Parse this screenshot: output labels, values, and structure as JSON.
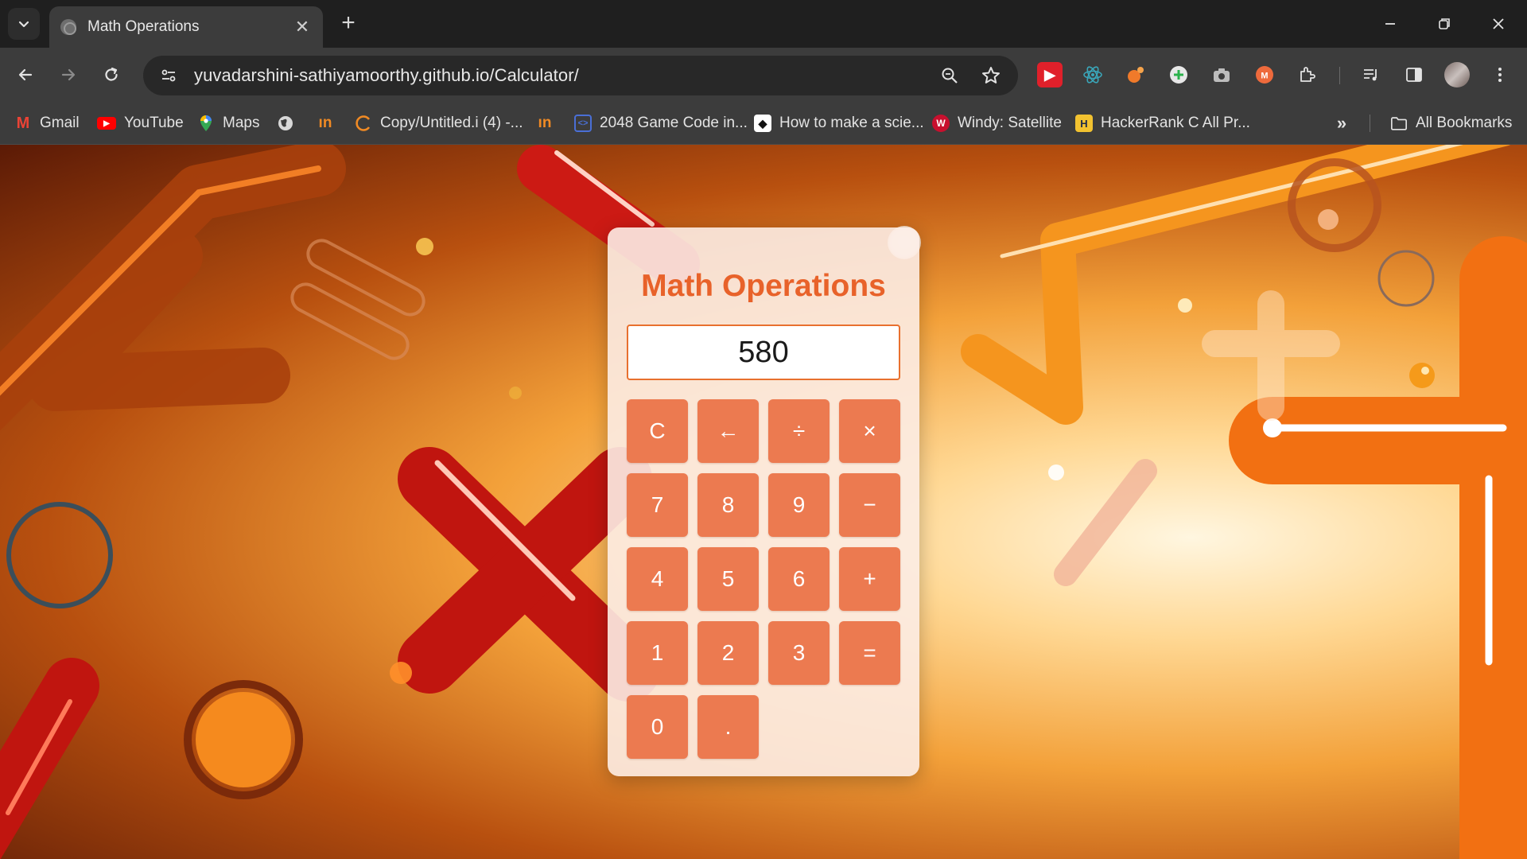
{
  "browser": {
    "tab": {
      "title": "Math Operations"
    },
    "url": "yuvadarshini-sathiyamoorthy.github.io/Calculator/",
    "bookmarks": [
      {
        "label": "Gmail",
        "icon": "gmail-icon"
      },
      {
        "label": "YouTube",
        "icon": "youtube-icon"
      },
      {
        "label": "Maps",
        "icon": "maps-icon"
      },
      {
        "label": "",
        "icon": "globe-icon"
      },
      {
        "label": "",
        "icon": "in-icon"
      },
      {
        "label": "Copy/Untitled.i (4) -...",
        "icon": "copy-icon"
      },
      {
        "label": "",
        "icon": "in-icon"
      },
      {
        "label": "2048 Game Code in...",
        "icon": "code-icon"
      },
      {
        "label": "How to make a scie...",
        "icon": "scie-icon"
      },
      {
        "label": "Windy: Satellite",
        "icon": "windy-icon"
      },
      {
        "label": "HackerRank C All Pr...",
        "icon": "hackerrank-icon"
      }
    ],
    "all_bookmarks": "All Bookmarks"
  },
  "calculator": {
    "title": "Math Operations",
    "display": "580",
    "keys": [
      "C",
      "←",
      "÷",
      "×",
      "7",
      "8",
      "9",
      "−",
      "4",
      "5",
      "6",
      "+",
      "1",
      "2",
      "3",
      "=",
      "0",
      "."
    ]
  },
  "colors": {
    "accent": "#e8622a",
    "key_bg": "#ec7a50",
    "panel_bg": "#fcece4",
    "chrome_dark": "#1f1f1f",
    "chrome_toolbar": "#3c3c3c"
  }
}
